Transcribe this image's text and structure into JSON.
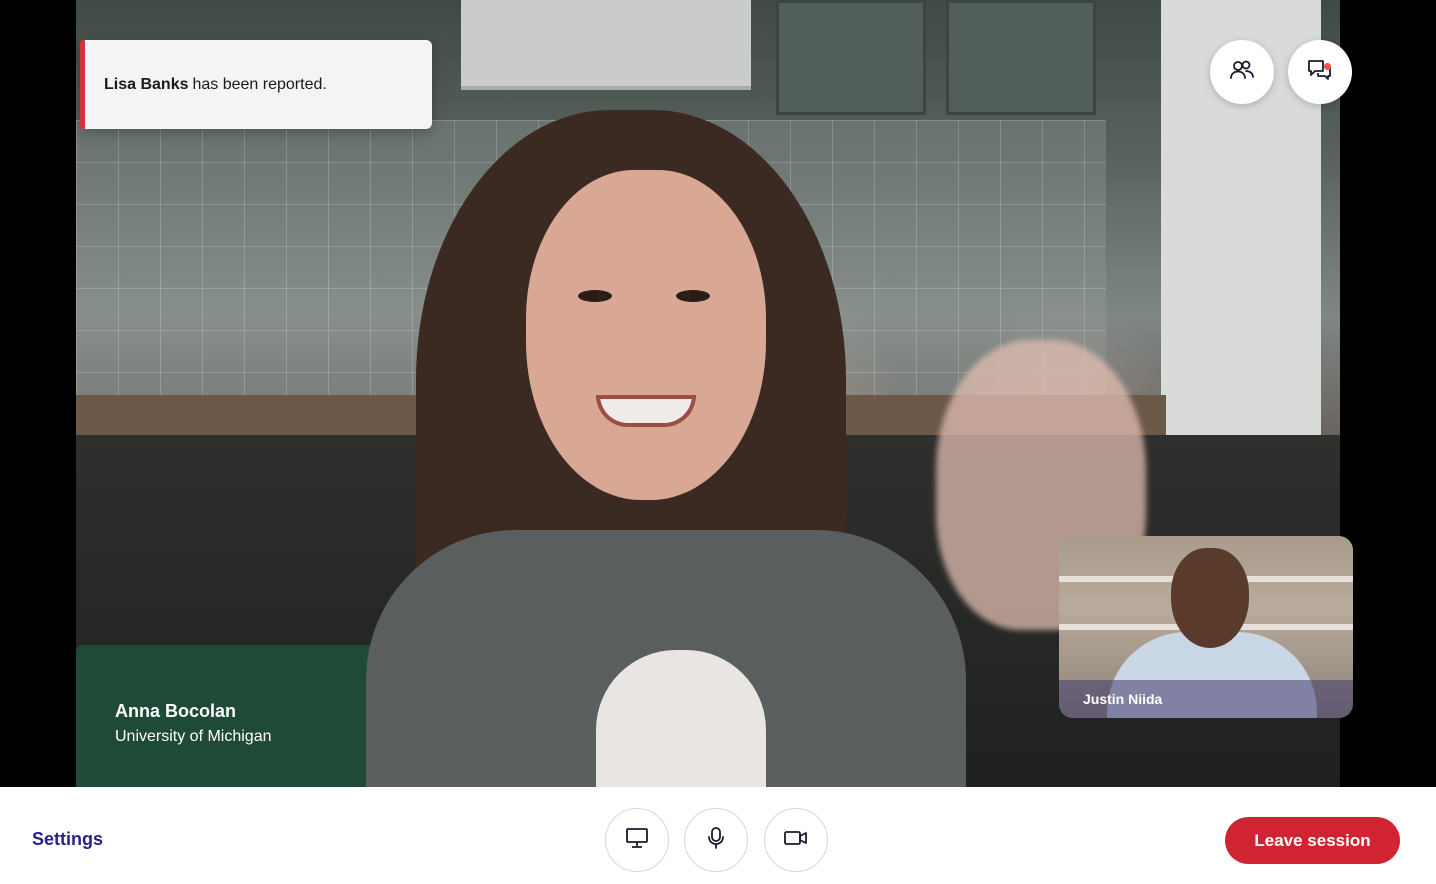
{
  "notification": {
    "reported_name": "Lisa Banks",
    "message": "has been reported."
  },
  "main_participant": {
    "name": "Anna Bocolan",
    "organization": "University of Michigan"
  },
  "pip_participant": {
    "name": "Justin Niida"
  },
  "top_controls": {
    "participants_icon": "people-icon",
    "chat_icon": "chat-bubbles-icon",
    "chat_has_notification": true
  },
  "bottom_bar": {
    "settings_label": "Settings",
    "controls": [
      "screen-share-icon",
      "microphone-icon",
      "camera-icon"
    ],
    "leave_label": "Leave session"
  },
  "colors": {
    "accent_red": "#d02433",
    "settings_link": "#24238c",
    "notify_dot": "#f2543d"
  }
}
